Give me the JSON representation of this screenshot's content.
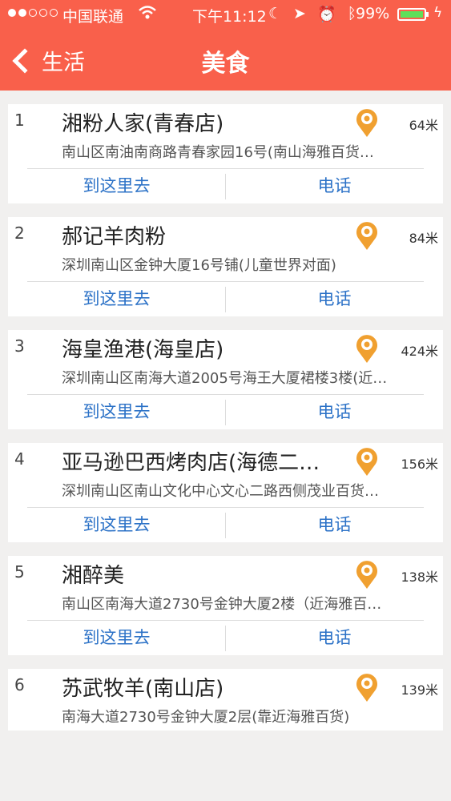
{
  "status_bar": {
    "carrier": "中国联通",
    "time": "下午11:12",
    "battery_percent": "99%",
    "signal_bars": 2,
    "icons": [
      "wifi-icon",
      "moon-icon",
      "location-arrow-icon",
      "alarm-icon",
      "bluetooth-icon",
      "battery-icon",
      "charging-icon"
    ]
  },
  "nav": {
    "back_label": "生活",
    "title": "美食"
  },
  "colors": {
    "header": "#f9604b",
    "link": "#2c72c7",
    "pin": "#f0a030"
  },
  "actions": {
    "go_label": "到这里去",
    "call_label": "电话"
  },
  "restaurants": [
    {
      "index": "1",
      "name": "湘粉人家(青春店)",
      "distance": "64米",
      "address": "南山区南油南商路青春家园16号(南山海雅百货…"
    },
    {
      "index": "2",
      "name": "郝记羊肉粉",
      "distance": "84米",
      "address": "深圳南山区金钟大厦16号铺(儿童世界对面)"
    },
    {
      "index": "3",
      "name": "海皇渔港(海皇店)",
      "distance": "424米",
      "address": "深圳南山区南海大道2005号海王大厦裙楼3楼(近…"
    },
    {
      "index": "4",
      "name": "亚马逊巴西烤肉店(海德二…",
      "distance": "156米",
      "address": "深圳南山区南山文化中心文心二路西侧茂业百货…"
    },
    {
      "index": "5",
      "name": "湘醉美",
      "distance": "138米",
      "address": "南山区南海大道2730号金钟大厦2楼（近海雅百…"
    },
    {
      "index": "6",
      "name": "苏武牧羊(南山店)",
      "distance": "139米",
      "address": "南海大道2730号金钟大厦2层(靠近海雅百货)"
    }
  ]
}
